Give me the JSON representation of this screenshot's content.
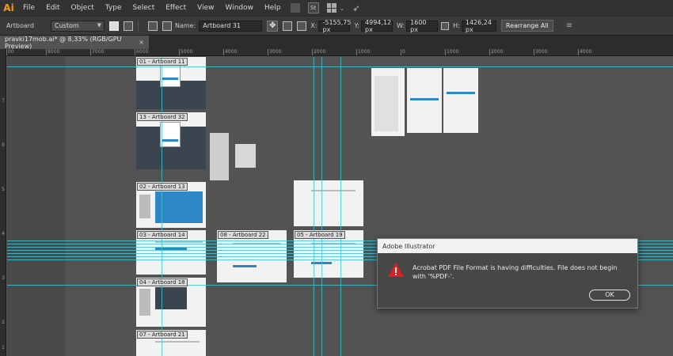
{
  "app": {
    "logo": "Ai"
  },
  "menu": [
    "File",
    "Edit",
    "Object",
    "Type",
    "Select",
    "Effect",
    "View",
    "Window",
    "Help"
  ],
  "menubar_icons": {
    "st_label": "St"
  },
  "control_bar": {
    "artboard_label": "Artboard",
    "preset_value": "Custom",
    "name_label": "Name:",
    "name_value": "Artboard 31",
    "x_label": "X:",
    "x_value": "-5155,75 px",
    "y_label": "Y:",
    "y_value": "4994,12 px",
    "w_label": "W:",
    "w_value": "1600 px",
    "h_label": "H:",
    "h_value": "1426,24 px",
    "rearrange_label": "Rearrange All"
  },
  "document_tab": {
    "title": "pravki17mob.ai* @ 8,33% (RGB/GPU Preview)",
    "close": "×"
  },
  "ruler_top": [
    "00",
    "8000",
    "7000",
    "6000",
    "5000",
    "4000",
    "3000",
    "2000",
    "1000",
    "0",
    "1000",
    "2000",
    "3000",
    "4000"
  ],
  "ruler_left": [
    "7",
    "6",
    "5",
    "4",
    "3",
    "2",
    "1"
  ],
  "artboards": [
    "01 - Artboard 11",
    "13 - Artboard 32",
    "02 - Artboard 13",
    "03 - Artboard 14",
    "08 - Artboard 22",
    "05 - Artboard 19",
    "04 - Artboard 18",
    "07 - Artboard 21"
  ],
  "dialog": {
    "title": "Adobe Illustrator",
    "message": "Acrobat PDF File Format is having difficulties. File does not begin with '%PDF-'.",
    "ok_label": "OK"
  },
  "colors": {
    "guide": "#3ec6d8",
    "accent": "#ff9a00",
    "error_icon": "#e02020",
    "artboard_blue": "#2f86c6"
  }
}
